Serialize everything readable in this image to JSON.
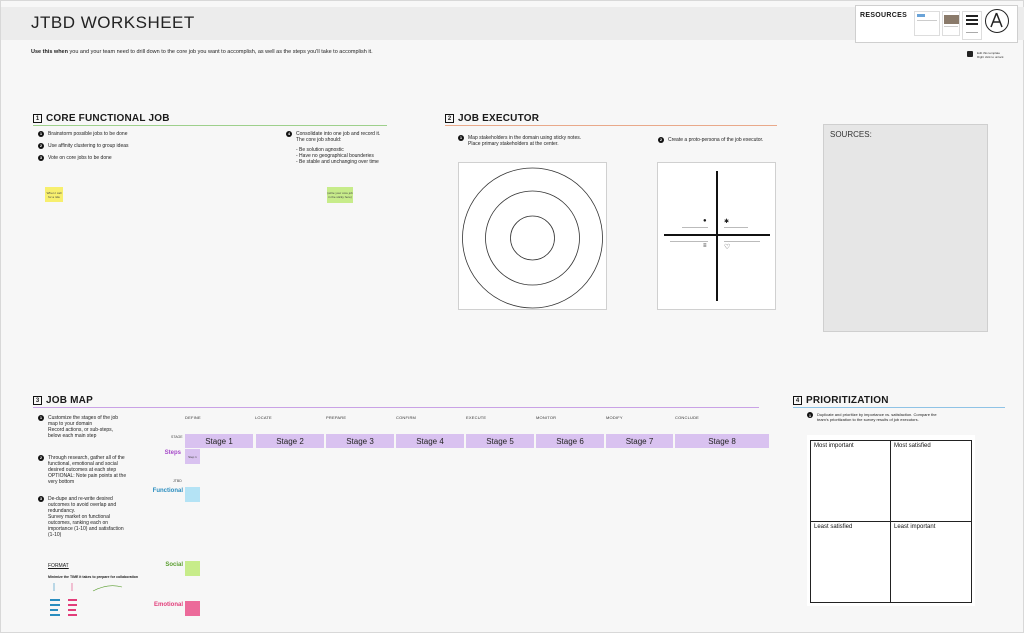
{
  "header": {
    "title": "JTBD WORKSHEET",
    "intro_bold": "Use this when",
    "intro_rest": " you and your team need to drill down to the core job you want to accomplish, as well as the steps you'll take to accomplish it."
  },
  "resources": {
    "title": "RESOURCES",
    "edit_tip_line1": "Edit this template",
    "edit_tip_line2": "Right click to unlock"
  },
  "core_functional_job": {
    "number": "1",
    "title": "CORE FUNCTIONAL JOB",
    "steps": [
      {
        "num": "1",
        "text": "Brainstorm possible jobs to be done"
      },
      {
        "num": "2",
        "text": "Use affinity clustering to group ideas"
      },
      {
        "num": "3",
        "text": "Vote on core jobs to be done"
      }
    ],
    "consolidate": {
      "num": "4",
      "line1": "Consolidate into one job and record it.",
      "line2": "The core job should:",
      "bullets": [
        "- Be solution agnostic",
        "- Have no geographical bounderies",
        "- Be stable and unchanging over time"
      ]
    },
    "note_yellow": "When I call for a ride",
    "note_green": "(write your core job in the sticky here)"
  },
  "job_executor": {
    "number": "2",
    "title": "JOB EXECUTOR",
    "step1_line1": "Map stakeholders in the domain using sticky notes.",
    "step1_line2": "Place primary stakeholders at the center.",
    "step2": "Create a proto-persona of the job executor."
  },
  "sources": {
    "label": "SOURCES:"
  },
  "job_map": {
    "number": "3",
    "title": "JOB MAP",
    "instructions": [
      {
        "num": "1",
        "lines": [
          "Customize the stages of the job",
          "map to your domain",
          "Record actions, or sub-steps,",
          "below each main step"
        ]
      },
      {
        "num": "2",
        "lines": [
          "Through research, gather all of the",
          "functional, emotional and social",
          "desired outcomes at each step",
          "OPTIONAL: Note pain points at the",
          "very bottom"
        ]
      },
      {
        "num": "3",
        "lines": [
          "De-dupe and re-write desired",
          "outcomes to avoid overlap and",
          "redundancy.",
          "Survey market on functional",
          "outcomes, ranking each on",
          "importance (1-10) and satisfaction",
          "(1-10)"
        ]
      }
    ],
    "format_label": "FORMAT",
    "format_text": "Minimize the TIME it takes to prepare for collaboration",
    "stage_label": "STAGE",
    "jtbd_label": "JTBD",
    "step_note": "Step 1",
    "columns": [
      "DEFINE",
      "LOCATE",
      "PREPARE",
      "CONFIRM",
      "EXECUTE",
      "MONITOR",
      "MODIFY",
      "CONCLUDE"
    ],
    "stages": [
      "Stage 1",
      "Stage 2",
      "Stage 3",
      "Stage 4",
      "Stage 5",
      "Stage 6",
      "Stage 7",
      "Stage 8"
    ],
    "rows": {
      "steps": "Steps",
      "functional": "Functional",
      "social": "Social",
      "emotional": "Emotional"
    }
  },
  "prioritization": {
    "number": "4",
    "title": "PRIORITIZATION",
    "instruction_line1": "Duplicate and prioritize by importance vs. satisfaction. Compare the",
    "instruction_line2": "team's prioritization to the survey results of job executors.",
    "cells": [
      "Most important",
      "Most satisfied",
      "Least satisfied",
      "Least important"
    ]
  },
  "colors": {
    "section1_rule": "#9ed08c",
    "section2_rule": "#e9a98a",
    "section3_rule": "#c9a2e6",
    "section4_rule": "#8fc3e6",
    "stage_fill": "#d9c2f0",
    "steps_label": "#a64ac9",
    "functional_label": "#2a8dbf",
    "social_label": "#5a9e2f",
    "emotional_label": "#e23d7a"
  }
}
